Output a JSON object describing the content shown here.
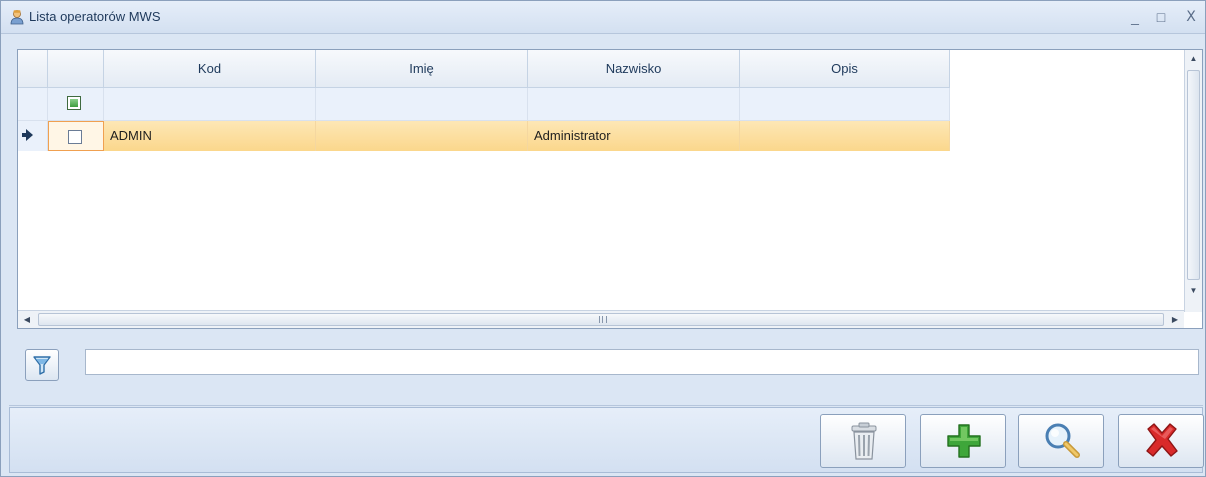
{
  "window": {
    "title": "Lista operatorów MWS",
    "controls": {
      "minimize": "_",
      "maximize": "□",
      "close": "X"
    }
  },
  "grid": {
    "columns": [
      {
        "key": "indicator",
        "label": ""
      },
      {
        "key": "check",
        "label": ""
      },
      {
        "key": "kod",
        "label": "Kod"
      },
      {
        "key": "imie",
        "label": "Imię"
      },
      {
        "key": "nazwisko",
        "label": "Nazwisko"
      },
      {
        "key": "opis",
        "label": "Opis"
      }
    ],
    "rows": [
      {
        "kod": "ADMIN",
        "imie": "",
        "nazwisko": "Administrator",
        "opis": "",
        "selected": true,
        "checked": false
      }
    ]
  },
  "filter": {
    "value": "",
    "placeholder": "",
    "icon": "funnel-icon"
  },
  "actions": {
    "delete": {
      "icon": "trash-icon"
    },
    "add": {
      "icon": "plus-icon"
    },
    "search": {
      "icon": "magnifier-icon"
    },
    "close": {
      "icon": "red-x-icon"
    }
  },
  "colors": {
    "selected_row": "#fbd78c",
    "header_text": "#1e395b",
    "add_green": "#3ea63a",
    "close_red": "#d92a2a"
  }
}
